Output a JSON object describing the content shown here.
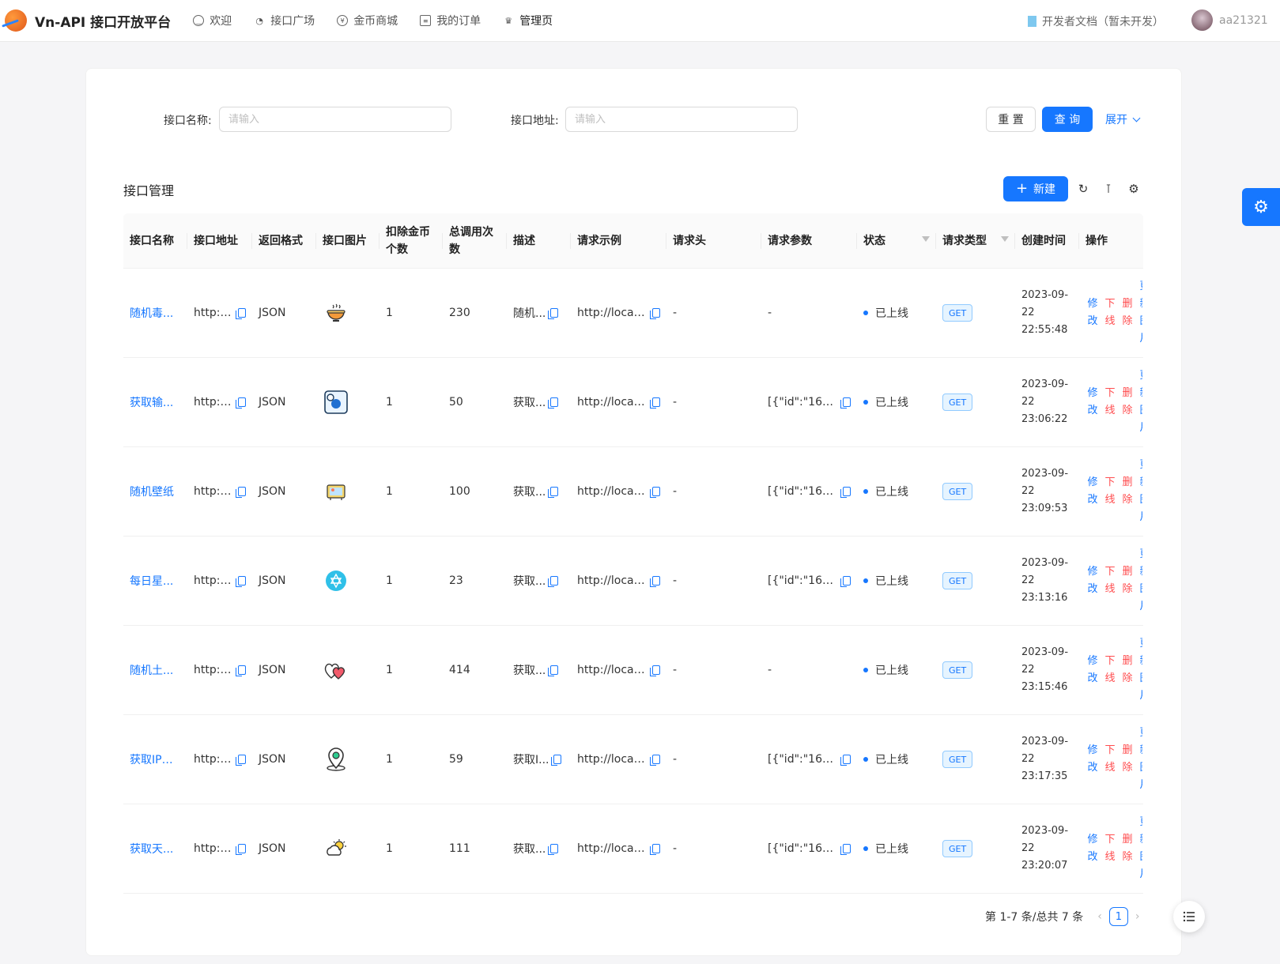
{
  "header": {
    "title": "Vn-API 接口开放平台",
    "nav": [
      {
        "label": "欢迎",
        "icon": "smile-icon"
      },
      {
        "label": "接口广场",
        "icon": "reddit-icon"
      },
      {
        "label": "金币商城",
        "icon": "yen-icon"
      },
      {
        "label": "我的订单",
        "icon": "order-icon"
      },
      {
        "label": "管理页",
        "icon": "crown-icon"
      }
    ],
    "doc_link": "开发者文档（暂未开发）",
    "username": "aa21321"
  },
  "search": {
    "name_label": "接口名称:",
    "name_placeholder": "请输入",
    "url_label": "接口地址:",
    "url_placeholder": "请输入",
    "reset": "重 置",
    "query": "查 询",
    "expand": "展开"
  },
  "toolbar": {
    "title": "接口管理",
    "new_button": "新建"
  },
  "table": {
    "columns": [
      "接口名称",
      "接口地址",
      "返回格式",
      "接口图片",
      "扣除金币个数",
      "总调用次数",
      "描述",
      "请求示例",
      "请求头",
      "请求参数",
      "状态",
      "请求类型",
      "创建时间",
      "操作"
    ],
    "rows": [
      {
        "name": "随机毒...",
        "url": "http:/...",
        "format": "JSON",
        "icon": "soup-bowl-icon",
        "coins": "1",
        "calls": "230",
        "desc": "随机...",
        "example": "http://localh...",
        "headers": "-",
        "params": "-",
        "status": "已上线",
        "method": "GET",
        "time": [
          "2023-09-",
          "22",
          "22:55:48"
        ]
      },
      {
        "name": "获取输...",
        "url": "http:/...",
        "format": "JSON",
        "icon": "search-box-icon",
        "coins": "1",
        "calls": "50",
        "desc": "获取...",
        "example": "http://localh...",
        "headers": "-",
        "params": "[{\"id\":\"1695...",
        "status": "已上线",
        "method": "GET",
        "time": [
          "2023-09-",
          "22",
          "23:06:22"
        ]
      },
      {
        "name": "随机壁纸",
        "url": "http:/...",
        "format": "JSON",
        "icon": "wallpaper-icon",
        "coins": "1",
        "calls": "100",
        "desc": "获取...",
        "example": "http://localh...",
        "headers": "-",
        "params": "[{\"id\":\"1695...",
        "status": "已上线",
        "method": "GET",
        "time": [
          "2023-09-",
          "22",
          "23:09:53"
        ]
      },
      {
        "name": "每日星...",
        "url": "http:/...",
        "format": "JSON",
        "icon": "star-badge-icon",
        "coins": "1",
        "calls": "23",
        "desc": "获取...",
        "example": "http://localh...",
        "headers": "-",
        "params": "[{\"id\":\"1695...",
        "status": "已上线",
        "method": "GET",
        "time": [
          "2023-09-",
          "22",
          "23:13:16"
        ]
      },
      {
        "name": "随机土...",
        "url": "http:/...",
        "format": "JSON",
        "icon": "hearts-icon",
        "coins": "1",
        "calls": "414",
        "desc": "获取...",
        "example": "http://localh...",
        "headers": "-",
        "params": "-",
        "status": "已上线",
        "method": "GET",
        "time": [
          "2023-09-",
          "22",
          "23:15:46"
        ]
      },
      {
        "name": "获取IP信...",
        "url": "http:/...",
        "format": "JSON",
        "icon": "location-pin-icon",
        "coins": "1",
        "calls": "59",
        "desc": "获取I...",
        "example": "http://localh...",
        "headers": "-",
        "params": "[{\"id\":\"1695...",
        "status": "已上线",
        "method": "GET",
        "time": [
          "2023-09-",
          "22",
          "23:17:35"
        ]
      },
      {
        "name": "获取天...",
        "url": "http:/...",
        "format": "JSON",
        "icon": "weather-icon",
        "coins": "1",
        "calls": "111",
        "desc": "获取...",
        "example": "http://localh...",
        "headers": "-",
        "params": "[{\"id\":\"1695...",
        "status": "已上线",
        "method": "GET",
        "time": [
          "2023-09-",
          "22",
          "23:20:07"
        ]
      }
    ],
    "ops": {
      "edit": [
        "修",
        "改"
      ],
      "offline": [
        "下",
        "线"
      ],
      "delete": [
        "删",
        "除"
      ],
      "update_pic": [
        "更",
        "新",
        "图",
        "片"
      ]
    }
  },
  "pagination": {
    "summary": "第 1-7 条/总共 7 条",
    "current": "1"
  },
  "colors": {
    "primary": "#1677ff",
    "danger": "#ff4d4f"
  }
}
